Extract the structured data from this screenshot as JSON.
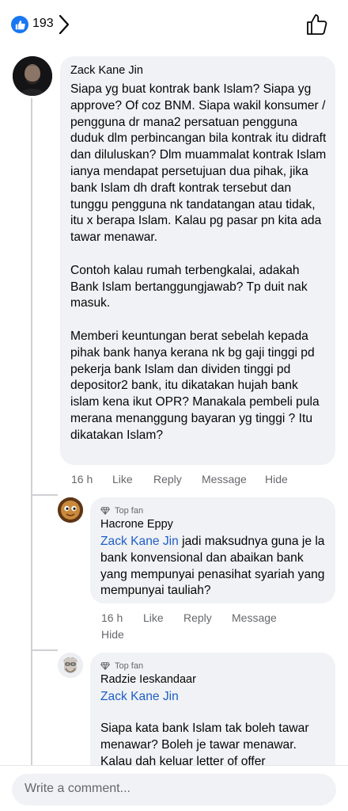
{
  "header": {
    "reaction_count": "193",
    "reaction_icon": "thumbs-up-icon",
    "chevron_icon": "chevron-right-icon",
    "like_button_icon": "thumbs-up-outline-icon"
  },
  "comments": [
    {
      "author": "Zack Kane Jin",
      "text": "Siapa yg buat kontrak bank Islam? Siapa yg approve? Of coz BNM. Siapa wakil konsumer / pengguna dr mana2 persatuan pengguna duduk dlm perbincangan bila kontrak itu didraft dan diluluskan? Dlm muammalat kontrak Islam ianya mendapat persetujuan dua pihak, jika bank Islam dh draft kontrak tersebut dan tunggu pengguna nk tandatangan atau tidak, itu x berapa Islam. Kalau pg pasar pn kita ada tawar menawar.\n\nContoh kalau rumah terbengkalai, adakah Bank Islam bertanggungjawab? Tp duit nak masuk.\n\nMemberi keuntungan berat sebelah kepada pihak bank hanya kerana nk bg gaji tinggi pd pekerja bank Islam dan dividen tinggi pd depositor2 bank, itu dikatakan hujah bank islam kena ikut OPR? Manakala pembeli pula merana menanggung bayaran yg tinggi ? Itu dikatakan Islam?",
      "time": "16 h",
      "like": "Like",
      "reply": "Reply",
      "message": "Message",
      "hide": "Hide"
    }
  ],
  "replies": [
    {
      "badge": "Top fan",
      "author": "Hacrone Eppy",
      "mention": "Zack Kane Jin",
      "text": " jadi maksudnya guna je la bank konvensional dan abaikan bank yang mempunyai penasihat syariah yang mempunyai tauliah?",
      "time": "16 h",
      "like": "Like",
      "reply": "Reply",
      "message": "Message",
      "hide": "Hide"
    },
    {
      "badge": "Top fan",
      "author": "Radzie Ieskandaar",
      "mention": "Zack Kane Jin",
      "text": "Siapa kata bank Islam tak boleh tawar menawar? Boleh je tawar menawar. Kalau dah keluar letter of offer"
    }
  ],
  "composer": {
    "placeholder": "Write a comment..."
  },
  "colors": {
    "facebook_blue": "#1877f2",
    "mention": "#1e5ec8",
    "bubble": "#f0f2f5",
    "secondary_text": "#65676b"
  }
}
